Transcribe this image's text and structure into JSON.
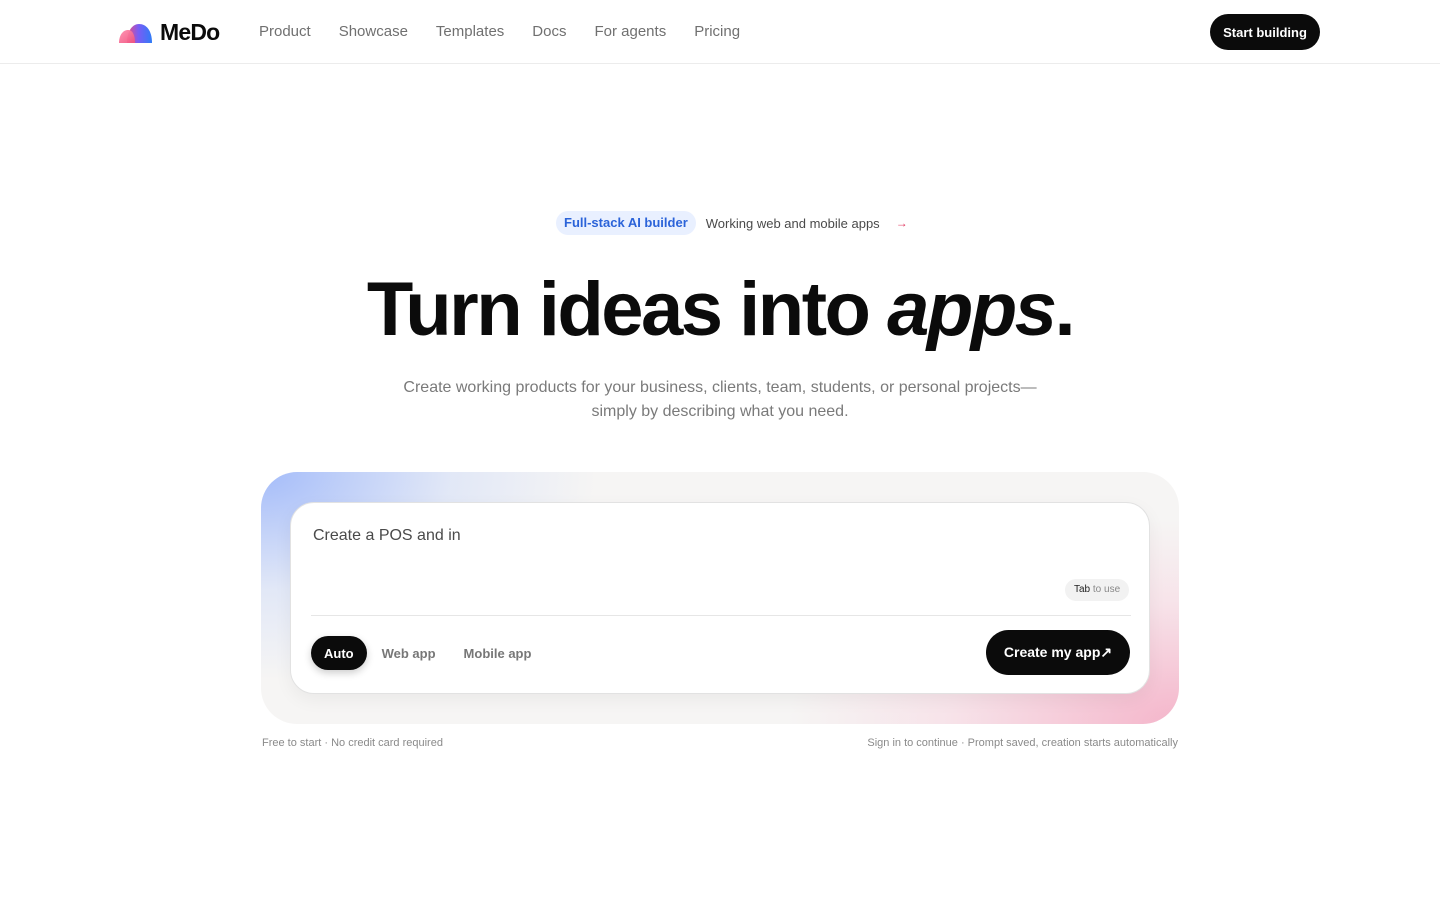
{
  "brand": {
    "name": "MeDo",
    "logo_icon": "medo-rainbow-logo",
    "colors": {
      "accent_blue": "#2b63d9",
      "accent_pink": "#e0315a",
      "primary_dark": "#0b0b0b"
    }
  },
  "nav": {
    "items": [
      "Product",
      "Showcase",
      "Templates",
      "Docs",
      "For agents",
      "Pricing"
    ]
  },
  "header": {
    "cta_label": "Start building"
  },
  "announcement": {
    "badge": "Full-stack AI builder",
    "text": "Working web and mobile apps",
    "arrow": "→"
  },
  "hero": {
    "title_main": "Turn ideas into ",
    "title_emphasis": "apps",
    "title_end": ".",
    "subtitle_line1": "Create working products for your business, clients, team, students, or personal projects—",
    "subtitle_line2": "simply by describing what you need."
  },
  "prompt": {
    "value": "Create a POS and in",
    "hint_key": "Tab",
    "hint_text": " to use",
    "modes": [
      {
        "label": "Auto",
        "active": true
      },
      {
        "label": "Web app",
        "active": false
      },
      {
        "label": "Mobile app",
        "active": false
      }
    ],
    "submit_label": "Create my app↗"
  },
  "footer_notes": {
    "left": "Free to start · No credit card required",
    "right": "Sign in to continue · Prompt saved, creation starts automatically"
  }
}
